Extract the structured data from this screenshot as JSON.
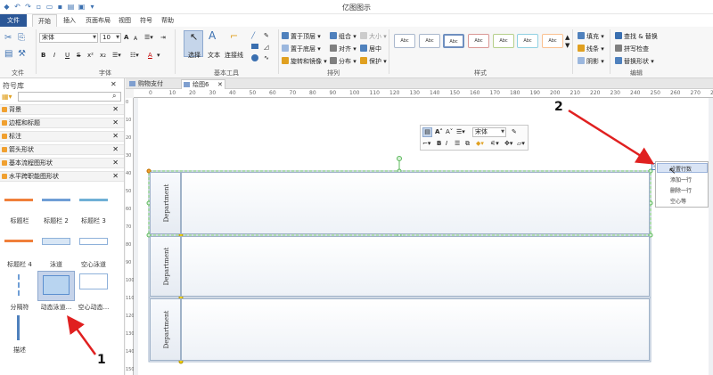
{
  "app": {
    "title": "亿图图示"
  },
  "ribbon_tabs": [
    "文件",
    "开始",
    "插入",
    "页面布局",
    "视图",
    "符号",
    "帮助"
  ],
  "ribbon": {
    "font": {
      "family": "宋体",
      "size": "10",
      "grow": "A",
      "shrink": "A",
      "bold": "B",
      "italic": "I",
      "underline": "U",
      "strike": "S",
      "superscript": "x²",
      "subscript": "x₂",
      "color": "A"
    },
    "tools": {
      "select": "选择",
      "text": "文本",
      "connector": "连接线"
    },
    "arrange": {
      "bring_front": "置于顶层",
      "send_back": "置于底层",
      "rotate": "旋转和镜像",
      "group": "组合",
      "align": "对齐",
      "distribute": "分布",
      "size": "大小",
      "center": "居中",
      "protect": "保护"
    },
    "style_swatch_label": "Abc",
    "style_swatch_colors": [
      "#a6a6a6",
      "#7f9fcf",
      "#4f81bd",
      "#c0504d",
      "#9bbb59",
      "#4bacc6",
      "#f79646"
    ],
    "fill": {
      "fill": "填充",
      "line": "线条",
      "shadow": "阴影"
    },
    "edit": {
      "find_replace": "查找 & 替换",
      "spell_check": "拼写检查",
      "replace_shape": "替换形状"
    },
    "group_labels": {
      "file": "文件",
      "font": "字体",
      "basic_tools": "基本工具",
      "arrange": "排列",
      "styles": "样式",
      "edit": "编辑"
    }
  },
  "left_panel": {
    "title": "符号库",
    "search_placeholder": "",
    "categories": [
      "背景",
      "边框和标题",
      "标注",
      "箭头形状",
      "基本流程图形状",
      "水平跨职能图形状"
    ],
    "shapes": [
      "标题栏",
      "标题栏 2",
      "标题栏 3",
      "标题栏 4",
      "泳道",
      "空心泳道",
      "分隔符",
      "动态泳道...",
      "空心动态...",
      "描述"
    ]
  },
  "doc_tabs": [
    "购物支付",
    "绘图6"
  ],
  "ruler": {
    "h_ticks": [
      "0",
      "10",
      "20",
      "30",
      "40",
      "50",
      "60",
      "70",
      "80",
      "90",
      "100",
      "110",
      "120",
      "130",
      "140",
      "150",
      "160",
      "170",
      "180",
      "190",
      "200",
      "210",
      "220",
      "230",
      "240",
      "250",
      "260",
      "270",
      "280"
    ],
    "v_ticks": [
      "0",
      "10",
      "20",
      "30",
      "40",
      "50",
      "60",
      "70",
      "80",
      "90",
      "100",
      "110",
      "120",
      "130",
      "140",
      "150"
    ]
  },
  "lanes": [
    "Department",
    "Department",
    "Department"
  ],
  "float_toolbar": {
    "font": "宋体"
  },
  "context_menu": [
    "设置行数",
    "添加一行",
    "删除一行",
    "空心等"
  ],
  "annotations": [
    "1",
    "2"
  ],
  "accent_color": "#2b5797",
  "arrow_color": "#e02020"
}
